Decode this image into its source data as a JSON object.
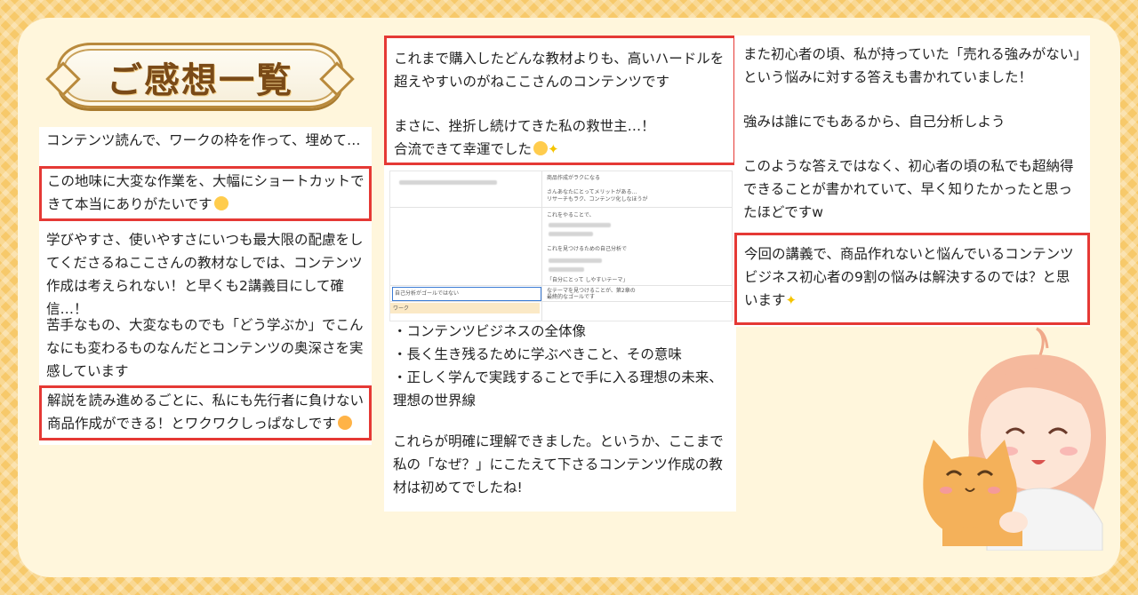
{
  "title": "ご感想一覧",
  "col1": {
    "intro": "コンテンツ読んで、ワークの枠を作って、埋めて…",
    "highlight1": "この地味に大変な作業を、大幅にショートカットできて本当にありがたいです",
    "para1": "学びやすさ、使いやすさにいつも最大限の配慮をしてくださるねここさんの教材なしでは、コンテンツ作成は考えられない！と早くも2講義目にして確信…！",
    "para2": "苦手なもの、大変なものでも「どう学ぶか」でこんなにも変わるものなんだとコンテンツの奥深さを実感しています",
    "highlight2": "解説を読み進めるごとに、私にも先行者に負けない商品作成ができる！とワクワクしっぱなしです"
  },
  "col2": {
    "highlight_a": "これまで購入したどんな教材よりも、高いハードルを超えやすいのがねここさんのコンテンツです",
    "highlight_b": "まさに、挫折し続けてきた私の救世主…！",
    "highlight_c": "合流できて幸運でした",
    "bullets": [
      "・コンテンツビジネスの全体像",
      "・長く生き残るために学ぶべきこと、その意味",
      "・正しく学んで実践することで手に入る理想の未来、理想の世界線"
    ],
    "closing": "これらが明確に理解できました。というか、ここまで私の「なぜ？」にこたえて下さるコンテンツ作成の教材は初めてでしたね!",
    "screenshot": {
      "row1": "商品作成がラクになる",
      "row2": "さんあなたにとってメリットがある…",
      "row3": "リサーチもラク、コンテンツ化しなほうが",
      "row4": "これをやることで、",
      "row5": "これを見つけるための自己分析で",
      "row6": "「自分にとって          しやすいテーマ」",
      "cell_left": "自己分析がゴールではない",
      "cell_right1": "なテーマを見つけることが、第2章の",
      "cell_right2": "最終的なゴールです",
      "section": "ワーク"
    }
  },
  "col3": {
    "para1": "また初心者の頃、私が持っていた「売れる強みがない」という悩みに対する答えも書かれていました！",
    "para2": "強みは誰にでもあるから、自己分析しよう",
    "para3": "このような答えではなく、初心者の頃の私でも超納得できることが書かれていて、早く知りたかったと思ったほどですw",
    "highlight": "今回の講義で、商品作れないと悩んでいるコンテンツビジネス初心者の9割の悩みは解決するのでは？と思います"
  },
  "colors": {
    "background": "#f7c96a",
    "panel": "#fff6dc",
    "highlight_border": "#e53935",
    "title_text": "#7a4a17"
  }
}
